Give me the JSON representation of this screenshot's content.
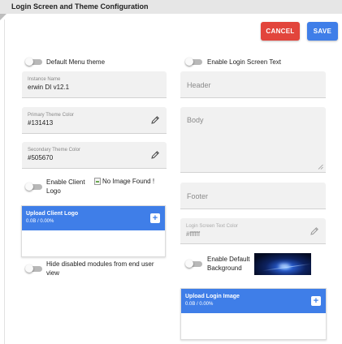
{
  "header": {
    "title": "Login Screen and Theme Configuration"
  },
  "actions": {
    "cancel_label": "CANCEL",
    "save_label": "SAVE"
  },
  "left": {
    "default_menu_theme_label": "Default Menu theme",
    "instance_name": {
      "label": "Instance Name",
      "value": "erwin DI v12.1"
    },
    "primary_theme_color": {
      "label": "Primary Theme Color",
      "value": "#131413"
    },
    "secondary_theme_color": {
      "label": "Secondary Theme Color",
      "value": "#505670"
    },
    "enable_client_logo_label_line1": "Enable Client",
    "enable_client_logo_label_line2": "Logo",
    "client_logo_alt": "No Image Found !",
    "upload_client_logo": {
      "title": "Upload Client Logo",
      "status": "0.0B / 0.00%"
    },
    "hide_disabled_label_line1": "Hide disabled modules from end user",
    "hide_disabled_label_line2": "view"
  },
  "right": {
    "enable_login_text_label": "Enable Login Screen Text",
    "header_placeholder": "Header",
    "body_placeholder": "Body",
    "footer_placeholder": "Footer",
    "login_text_color": {
      "label": "Login Screen Text Color",
      "value": "#ffffff"
    },
    "enable_default_bg_label_line1": "Enable Default",
    "enable_default_bg_label_line2": "Background",
    "upload_login_image": {
      "title": "Upload Login Image",
      "status": "0.0B / 0.00%"
    }
  },
  "colors": {
    "cancel": "#e2453c",
    "save": "#3f7ee8",
    "upload_header": "#3f7ee8",
    "field_bg": "#f1f1f1"
  },
  "icons": [
    "pencil-icon",
    "plus-icon",
    "broken-image-icon",
    "resize-handle-icon"
  ]
}
